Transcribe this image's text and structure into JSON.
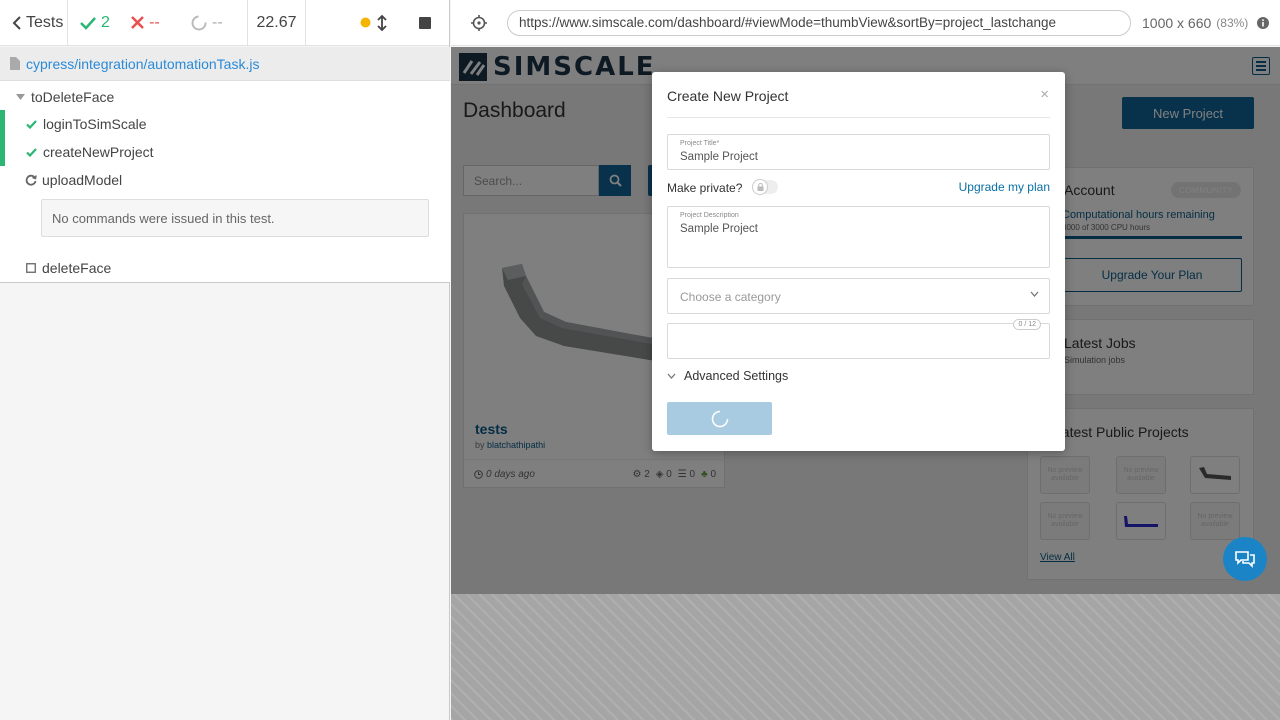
{
  "runner": {
    "back_label": "Tests",
    "passed": "2",
    "failed": "--",
    "pending": "--",
    "duration": "22.67",
    "spec_path": "cypress/integration/automationTask.js",
    "suite_name": "toDeleteFace",
    "tests": [
      {
        "name": "loginToSimScale",
        "state": "passed"
      },
      {
        "name": "createNewProject",
        "state": "passed"
      },
      {
        "name": "uploadModel",
        "state": "running"
      },
      {
        "name": "deleteFace",
        "state": "pending"
      }
    ],
    "no_commands": "No commands were issued in this test."
  },
  "browser": {
    "url": "https://www.simscale.com/dashboard/#viewMode=thumbView&sortBy=project_lastchange",
    "viewport": "1000 x 660",
    "scale": "(83%)"
  },
  "app": {
    "logo_text": "SIMSCALE",
    "page_title": "Dashboard",
    "new_project_label": "New Project",
    "search_placeholder": "Search...",
    "project_card": {
      "title": "tests",
      "by_prefix": "by",
      "author": "blatchathipathi",
      "age": "0 days ago",
      "stats": [
        "2",
        "0",
        "0",
        "0"
      ]
    },
    "account": {
      "title": "Account",
      "badge": "COMMUNITY",
      "hours_label": "Computational hours remaining",
      "hours_sub": "3000 of 3000 CPU hours",
      "upgrade_label": "Upgrade Your Plan"
    },
    "jobs": {
      "title": "Latest Jobs",
      "sub": "Simulation jobs"
    },
    "public_projects": {
      "title": "Latest Public Projects",
      "no_preview": "No preview available",
      "view_all": "View All"
    }
  },
  "modal": {
    "title": "Create New Project",
    "close": "×",
    "project_title_label": "Project Title*",
    "project_title_value": "Sample Project",
    "private_label": "Make private?",
    "upgrade_link": "Upgrade my plan",
    "description_label": "Project Description",
    "description_value": "Sample Project",
    "category_placeholder": "Choose a category",
    "tag_count": "0 / 12",
    "advanced_label": "Advanced Settings"
  },
  "colors": {
    "pass_green": "#2bb673",
    "fail_red": "#e94f4f",
    "brand_blue": "#106499",
    "link_blue": "#2a8ad8"
  }
}
